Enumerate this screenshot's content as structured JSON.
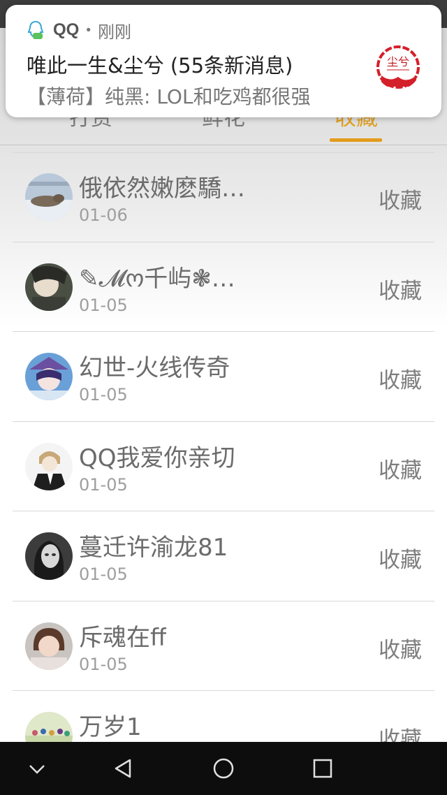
{
  "notification": {
    "app_name": "QQ",
    "separator": "•",
    "time": "刚刚",
    "title": "唯此一生&尘兮 (55条新消息)",
    "text": "【薄荷】纯黑: LOL和吃鸡都很强",
    "avatar_text": "尘兮"
  },
  "tabs": [
    {
      "label": "打赏"
    },
    {
      "label": "鲜花"
    },
    {
      "label": "收藏"
    }
  ],
  "active_tab_color": "#e39c1c",
  "list": [
    {
      "name": "俄依然嫩麽驕…",
      "date": "01-06",
      "action": "收藏",
      "avatar": "seal-on-ice-avatar"
    },
    {
      "name": "✎𝓜ო千屿❃…",
      "date": "01-05",
      "action": "收藏",
      "avatar": "anime-boy-avatar"
    },
    {
      "name": "幻世-火线传奇",
      "date": "01-05",
      "action": "收藏",
      "avatar": "anime-girl-avatar"
    },
    {
      "name": "QQ我爱你亲切",
      "date": "01-05",
      "action": "收藏",
      "avatar": "anime-suit-avatar"
    },
    {
      "name": "蔓迁许渝龙81",
      "date": "01-05",
      "action": "收藏",
      "avatar": "bw-woman-avatar"
    },
    {
      "name": "斥魂在ff",
      "date": "01-05",
      "action": "收藏",
      "avatar": "child-photo-avatar"
    },
    {
      "name": "万岁1",
      "date": "",
      "action": "收藏",
      "avatar": "group-photo-avatar"
    }
  ],
  "nav": {
    "icons": [
      "chevron-down-icon",
      "back-triangle-icon",
      "home-circle-icon",
      "recent-square-icon"
    ]
  }
}
